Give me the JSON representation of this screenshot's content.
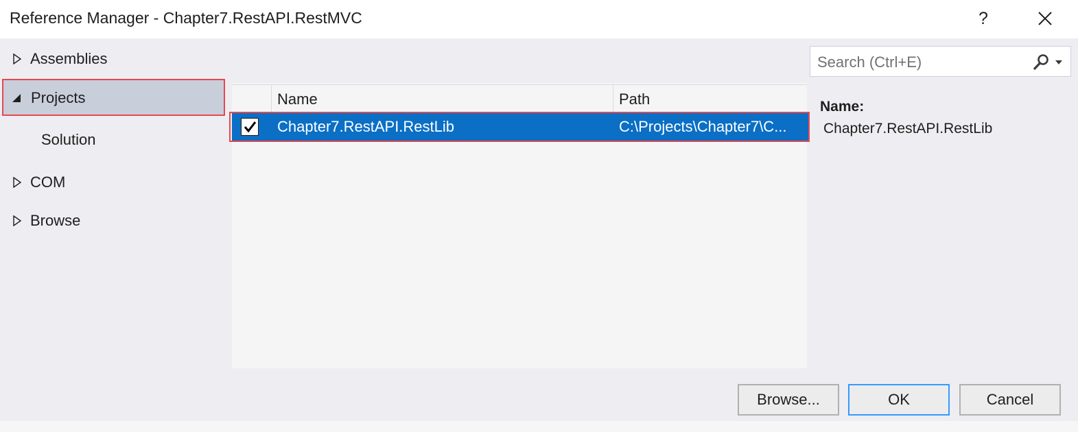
{
  "window": {
    "title": "Reference Manager - Chapter7.RestAPI.RestMVC",
    "help_label": "?"
  },
  "tree": {
    "items": [
      {
        "label": "Assemblies",
        "state": "collapsed"
      },
      {
        "label": "Projects",
        "state": "expanded"
      },
      {
        "label": "Solution",
        "state": "child"
      },
      {
        "label": "COM",
        "state": "collapsed"
      },
      {
        "label": "Browse",
        "state": "collapsed"
      }
    ]
  },
  "search": {
    "placeholder": "Search (Ctrl+E)"
  },
  "list": {
    "columns": [
      "Name",
      "Path"
    ],
    "rows": [
      {
        "checked": true,
        "name": "Chapter7.RestAPI.RestLib",
        "path": "C:\\Projects\\Chapter7\\C..."
      }
    ]
  },
  "details": {
    "label": "Name:",
    "value": "Chapter7.RestAPI.RestLib"
  },
  "buttons": {
    "browse": "Browse...",
    "ok": "OK",
    "cancel": "Cancel"
  },
  "colors": {
    "accent": "#0a6fc5",
    "highlight_border": "#e5484d",
    "selected_tree_bg": "#c9cedb",
    "default_button_border": "#3399ff"
  }
}
